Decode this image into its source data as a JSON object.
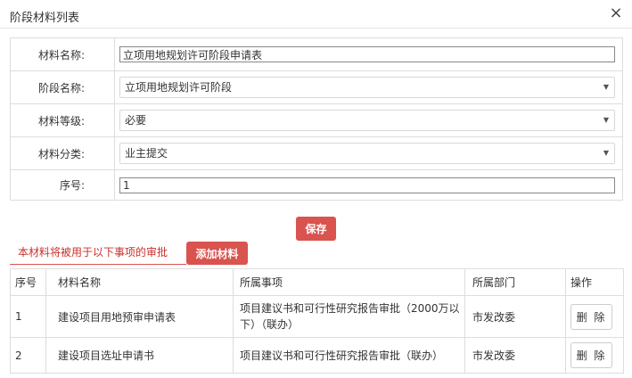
{
  "dialog": {
    "title": "阶段材料列表",
    "close_glyph": "×"
  },
  "form": {
    "material_name_label": "材料名称:",
    "material_name_value": "立项用地规划许可阶段申请表",
    "stage_name_label": "阶段名称:",
    "stage_name_value": "立项用地规划许可阶段",
    "material_level_label": "材料等级:",
    "material_level_value": "必要",
    "material_category_label": "材料分类:",
    "material_category_value": "业主提交",
    "sequence_label": "序号:",
    "sequence_value": "1",
    "caret_glyph": "▼"
  },
  "save_label": "保存",
  "section": {
    "title": "本材料将被用于以下事项的审批",
    "add_label": "添加材料"
  },
  "table": {
    "headers": {
      "index": "序号",
      "name": "材料名称",
      "item": "所属事项",
      "dept": "所属部门",
      "op": "操作"
    },
    "rows": [
      {
        "index": "1",
        "name": "建设项目用地预审申请表",
        "item": "项目建议书和可行性研究报告审批（2000万以下）（联办）",
        "dept": "市发改委",
        "op": "删 除"
      },
      {
        "index": "2",
        "name": "建设项目选址申请书",
        "item": "项目建议书和可行性研究报告审批（联办）",
        "dept": "市发改委",
        "op": "删 除"
      }
    ]
  }
}
